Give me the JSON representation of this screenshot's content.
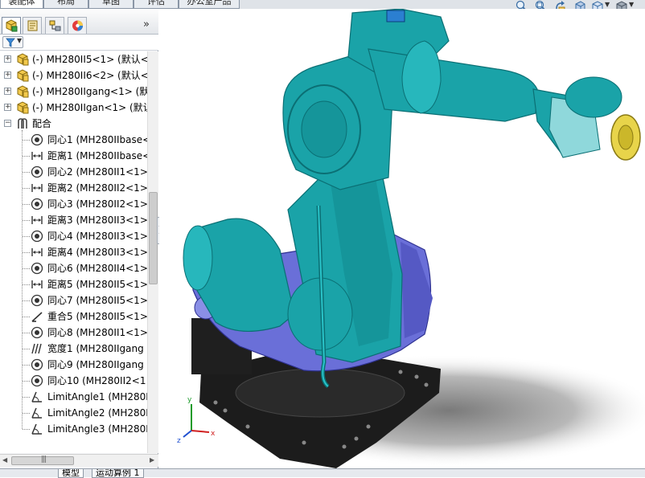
{
  "command_tabs": [
    "装配体",
    "布局",
    "草图",
    "评估",
    "办公室产品"
  ],
  "view_toolbar": {
    "icons": [
      "zoom-to-fit-icon",
      "zoom-area-icon",
      "previous-view-icon",
      "section-view-icon",
      "view-orientation-icon",
      "display-style-icon"
    ]
  },
  "panel_tabs": [
    "featuremanager-tab",
    "propertymanager-tab",
    "configurationmanager-tab",
    "displaymanager-tab"
  ],
  "panel_expand": "»",
  "tree": {
    "components": [
      "(-) MH280II5<1> (默认<",
      "(-) MH280II6<2> (默认<",
      "(-) MH280IIgang<1> (默",
      "(-) MH280IIgan<1> (默认"
    ],
    "mates_folder": "配合",
    "mates": [
      {
        "icon": "concentric",
        "label": "同心1 (MH280IIbase<"
      },
      {
        "icon": "distance",
        "label": "距离1 (MH280IIbase<"
      },
      {
        "icon": "concentric",
        "label": "同心2 (MH280II1<1>"
      },
      {
        "icon": "distance",
        "label": "距离2 (MH280II2<1>"
      },
      {
        "icon": "concentric",
        "label": "同心3 (MH280II2<1>"
      },
      {
        "icon": "distance",
        "label": "距离3 (MH280II3<1>"
      },
      {
        "icon": "concentric",
        "label": "同心4 (MH280II3<1>"
      },
      {
        "icon": "distance",
        "label": "距离4 (MH280II3<1>"
      },
      {
        "icon": "concentric",
        "label": "同心6 (MH280II4<1>"
      },
      {
        "icon": "distance",
        "label": "距离5 (MH280II5<1>"
      },
      {
        "icon": "concentric",
        "label": "同心7 (MH280II5<1>"
      },
      {
        "icon": "coincident",
        "label": "重合5 (MH280II5<1>"
      },
      {
        "icon": "concentric",
        "label": "同心8 (MH280II1<1>"
      },
      {
        "icon": "width",
        "label": "宽度1 (MH280IIgang"
      },
      {
        "icon": "concentric",
        "label": "同心9 (MH280IIgang"
      },
      {
        "icon": "concentric",
        "label": "同心10 (MH280II2<1"
      },
      {
        "icon": "limitangle",
        "label": "LimitAngle1 (MH280I"
      },
      {
        "icon": "limitangle",
        "label": "LimitAngle2 (MH280I"
      },
      {
        "icon": "limitangle",
        "label": "LimitAngle3 (MH280I"
      }
    ]
  },
  "bottom_tabs": [
    "模型",
    "运动算例 1"
  ],
  "triad": {
    "x": "x",
    "y": "y",
    "z": "z"
  },
  "colors": {
    "robot_teal": "#1aa3a8",
    "robot_dark": "#0b6f74",
    "base_purple": "#6a6fd8",
    "base_black": "#1c1c1c",
    "flange_yellow": "#e8d44a"
  }
}
